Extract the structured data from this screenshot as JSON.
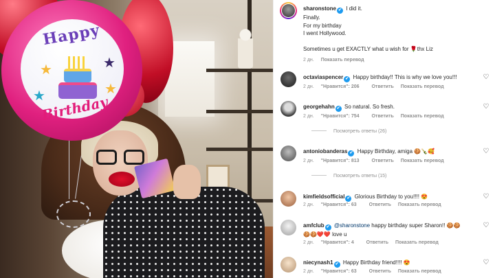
{
  "post": {
    "author": "sharonstone",
    "caption_lines": [
      "I did it.",
      "Finally.",
      "For my birthday",
      "I went Hollywood."
    ],
    "caption_extra": "Sometimes u get EXACTLY what u wish for",
    "caption_extra_emoji": "🌹",
    "caption_tail": "thx Liz",
    "time": "2 дн.",
    "translate": "Показать перевод"
  },
  "photo": {
    "balloon_top": "Happy",
    "balloon_bottom": "Birthday"
  },
  "labels": {
    "likes_prefix": "\"Нравится\":",
    "reply": "Ответить",
    "translate": "Показать перевод",
    "view_replies": "Посмотреть ответы"
  },
  "comments": [
    {
      "user": "octaviaspencer",
      "text": "Happy birthday!! This is why we love you!!!",
      "time": "2 дн.",
      "likes": "206",
      "replies": ""
    },
    {
      "user": "georgehahn",
      "text": "So natural. So fresh.",
      "time": "2 дн.",
      "likes": "754",
      "replies": "(26)"
    },
    {
      "user": "antoniobanderas",
      "text": "Happy Birthday, amiga",
      "emoji": "🍪🍾🥰",
      "time": "2 дн.",
      "likes": "813",
      "replies": "(15)"
    },
    {
      "user": "kimfieldsofficial",
      "text": "Glorious Birthday to you!!!!",
      "emoji": "😍",
      "time": "2 дн.",
      "likes": "63",
      "replies": ""
    },
    {
      "user": "amfclub",
      "mention": "@sharonstone",
      "text": "happy birthday super Sharon!!",
      "emoji": "🍪🍪",
      "text2": "love u",
      "emoji2": "🍪🍪❤️❤️",
      "time": "2 дн.",
      "likes": "4",
      "replies": ""
    },
    {
      "user": "niecynash1",
      "text": "Happy Birthday friend!!!!",
      "emoji": "😍",
      "time": "2 дн.",
      "likes": "63",
      "replies": ""
    }
  ],
  "icons": {
    "verified": "✔",
    "heart": "♡"
  }
}
